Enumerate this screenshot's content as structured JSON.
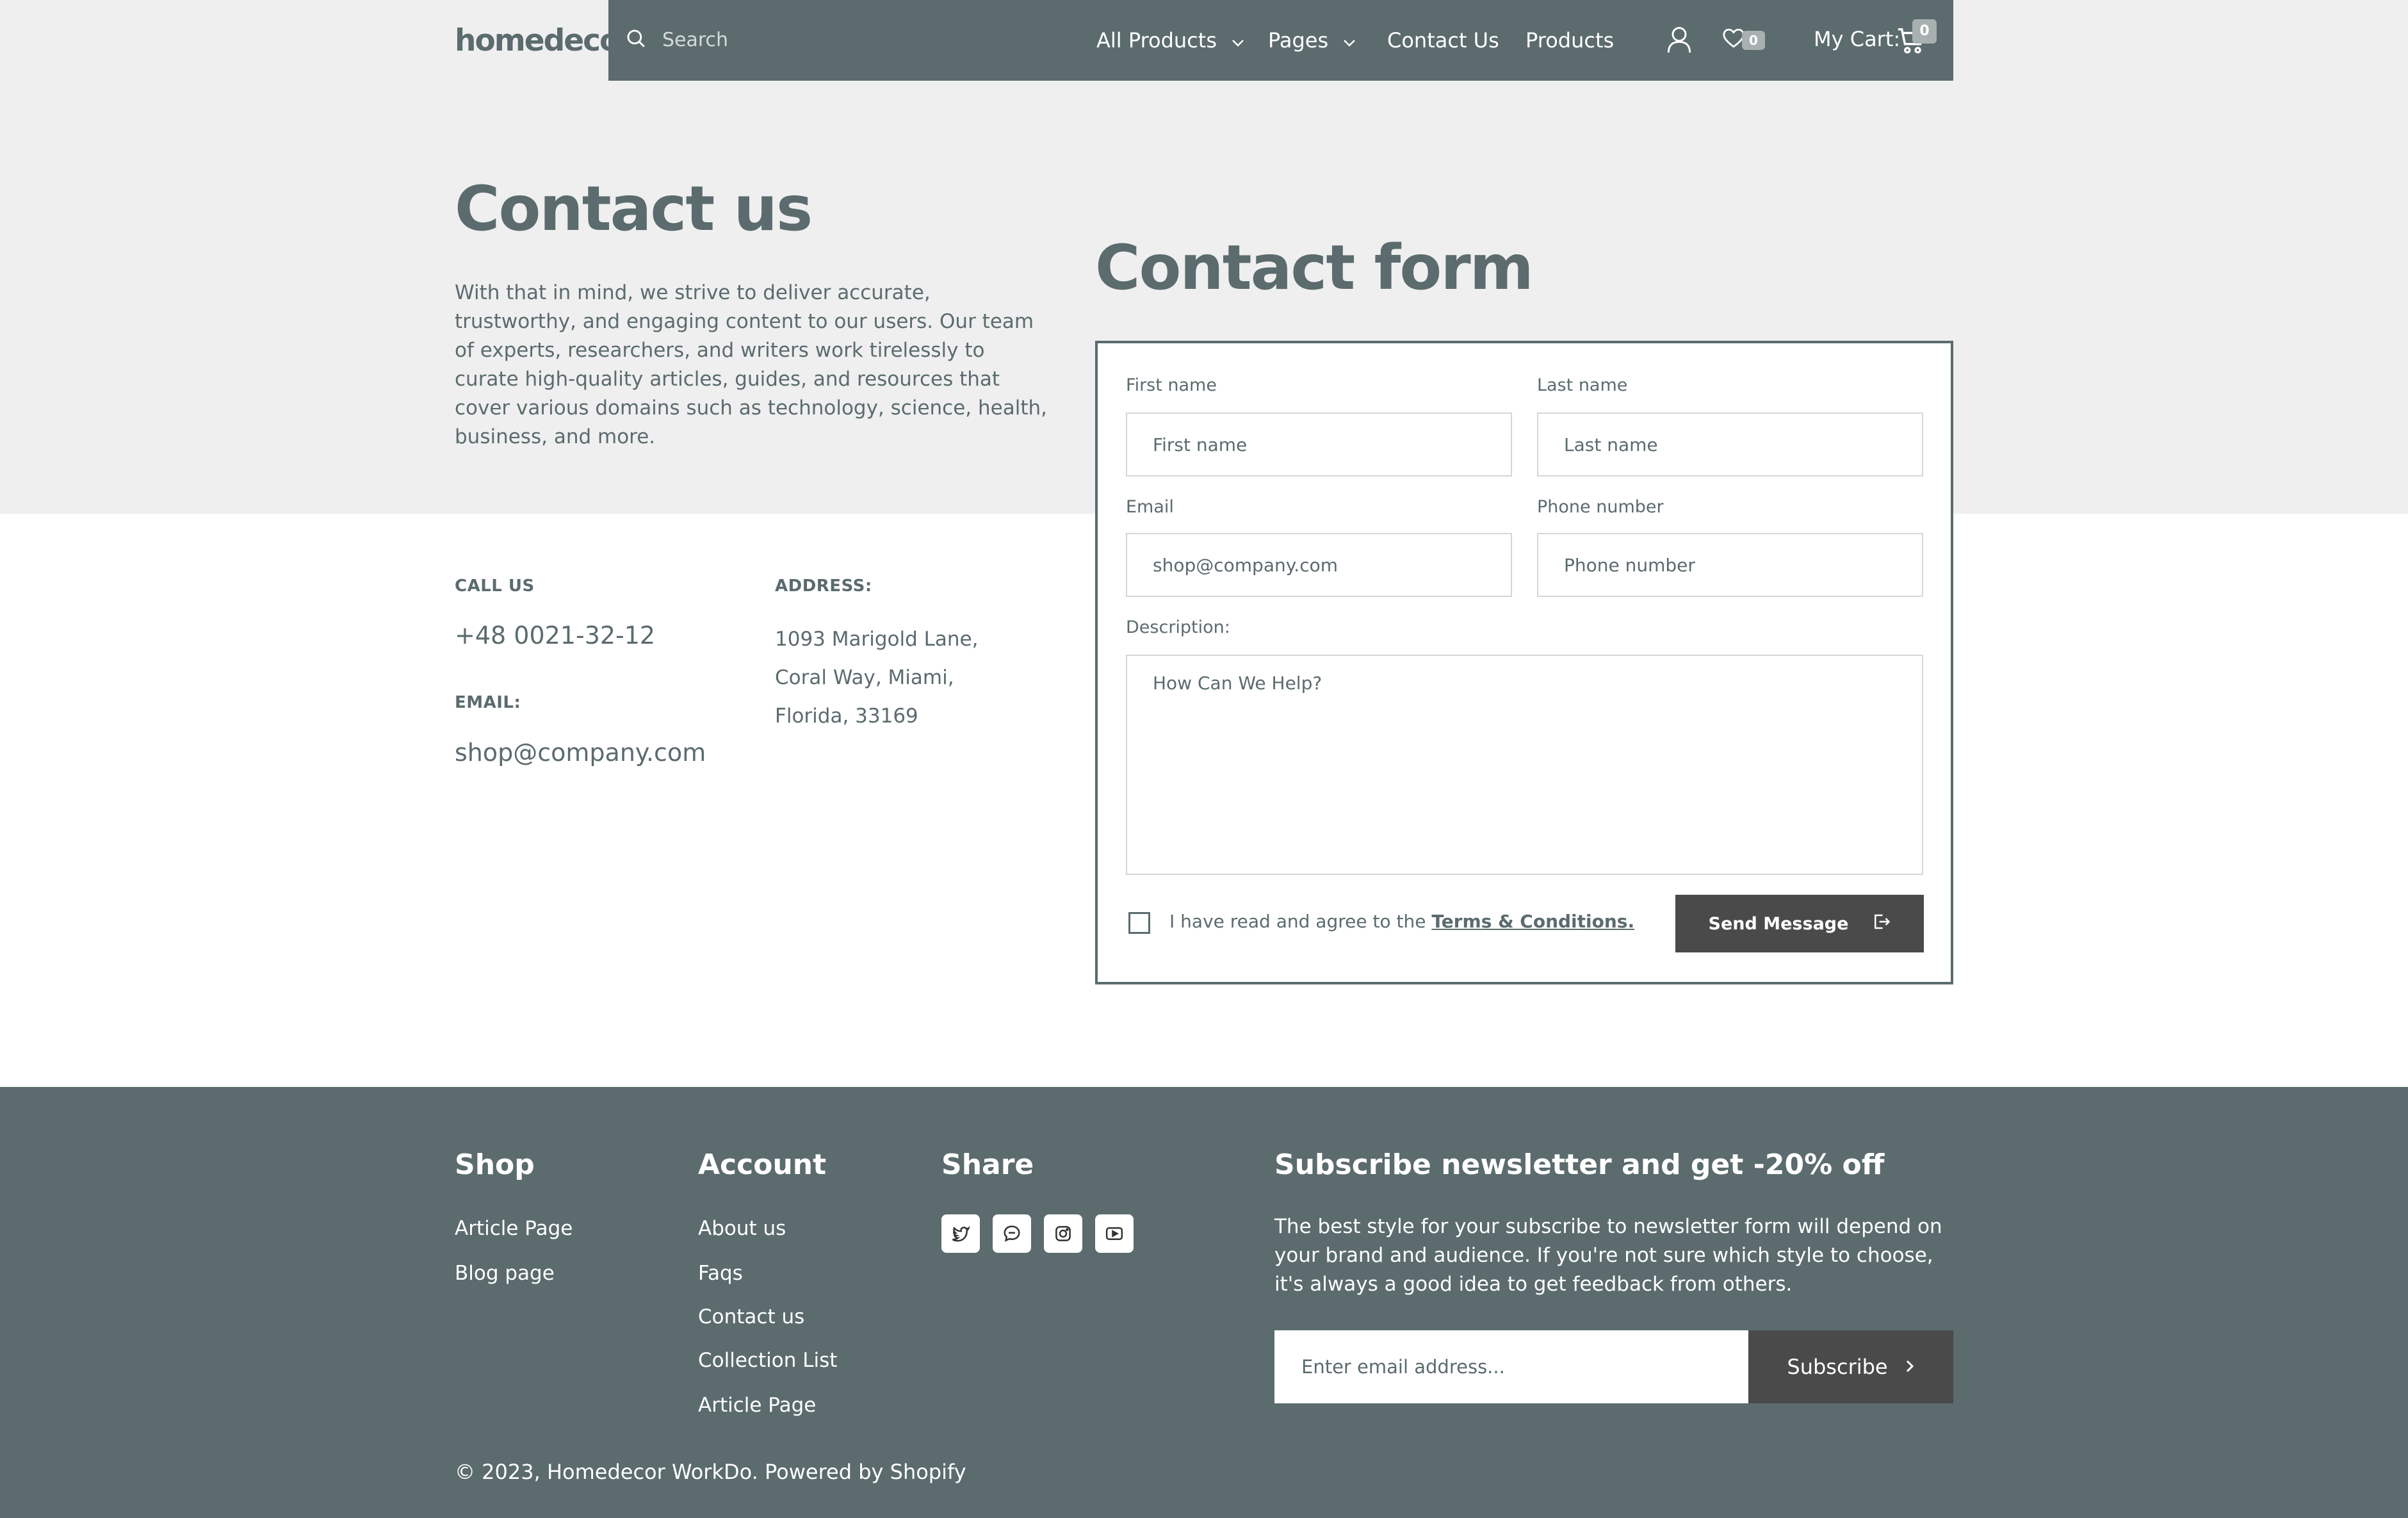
{
  "header": {
    "logo": "homedecor",
    "search_placeholder": "Search",
    "nav": {
      "all_products": "All Products",
      "pages": "Pages",
      "contact_us": "Contact Us",
      "products": "Products"
    },
    "wishlist_count": "0",
    "cart_label": "My Cart:",
    "cart_count": "0"
  },
  "intro": {
    "title": "Contact us",
    "text": "With that in mind, we strive to deliver accurate, trustworthy, and engaging content to our users. Our team of experts, researchers, and writers work tirelessly to curate high-quality articles, guides, and resources that cover various domains such as technology, science, health, business, and more."
  },
  "contact_info": {
    "call_label": "CALL US",
    "phone": "+48 0021-32-12",
    "email_label": "EMAIL:",
    "email": "shop@company.com",
    "address_label": "ADDRESS:",
    "address_lines": [
      "1093 Marigold Lane,",
      "Coral Way, Miami,",
      "Florida, 33169"
    ]
  },
  "form": {
    "title": "Contact form",
    "first_name_label": "First name",
    "first_name_placeholder": "First name",
    "last_name_label": "Last name",
    "last_name_placeholder": "Last name",
    "email_label": "Email",
    "email_placeholder": "shop@company.com",
    "phone_label": "Phone number",
    "phone_placeholder": "Phone number",
    "description_label": "Description:",
    "description_placeholder": "How Can We Help?",
    "agree_text": "I have read and agree to the",
    "terms_link": "Terms & Conditions.",
    "send_label": "Send Message"
  },
  "footer": {
    "shop_heading": "Shop",
    "shop_links": [
      "Article Page",
      "Blog page"
    ],
    "account_heading": "Account",
    "account_links": [
      "About us",
      "Faqs",
      "Contact us",
      "Collection List",
      "Article Page"
    ],
    "share_heading": "Share",
    "social_icons": [
      "twitter-icon",
      "message-icon",
      "instagram-icon",
      "youtube-icon"
    ],
    "newsletter_heading": "Subscribe newsletter and get -20% off",
    "newsletter_text": "The best style for your subscribe to newsletter form will depend on your brand and audience. If you're not sure which style to choose, it's always a good idea to get feedback from others.",
    "newsletter_placeholder": "Enter email address...",
    "subscribe_label": "Subscribe",
    "copyright": "© 2023, Homedecor WorkDo. Powered by Shopify"
  },
  "colors": {
    "primary": "#5b6b6e",
    "dark_button": "#4a4a4a",
    "hero_bg": "#efefef"
  }
}
